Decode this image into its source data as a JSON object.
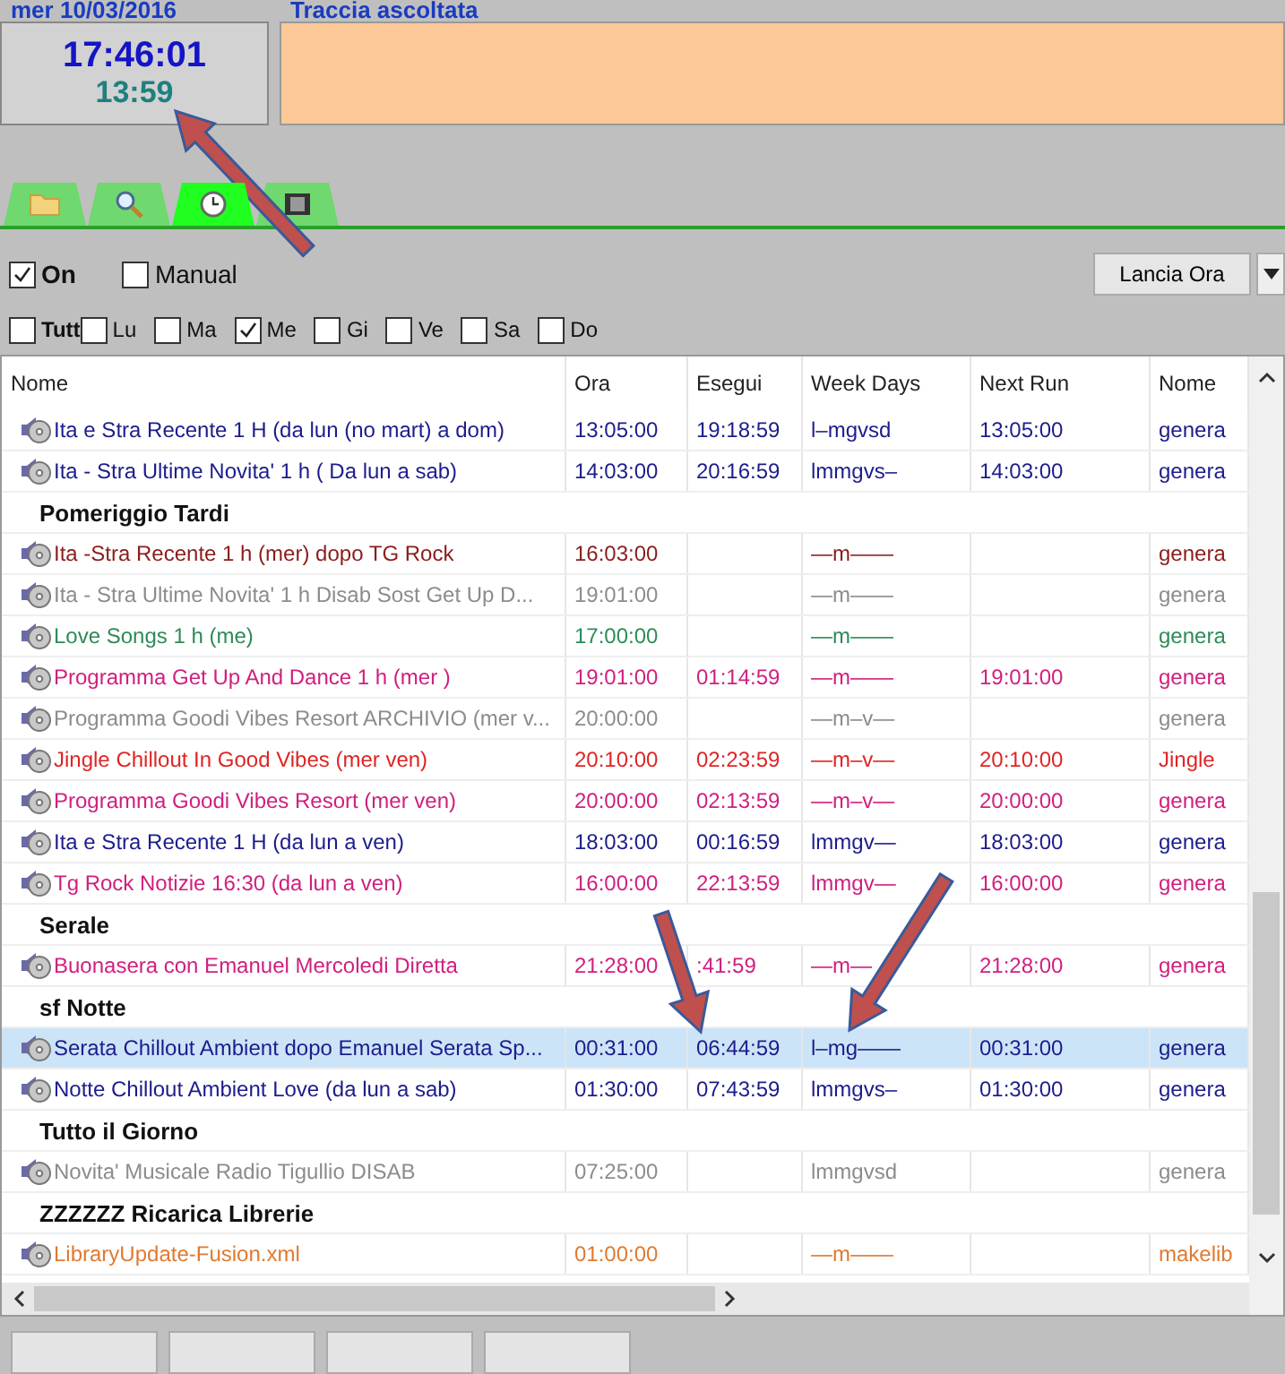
{
  "header": {
    "date": "mer 10/03/2016",
    "track_label": "Traccia ascoltata"
  },
  "clock": {
    "time": "17:46:01",
    "countdown": "13:59"
  },
  "tabs": [
    {
      "selected": false
    },
    {
      "selected": false
    },
    {
      "selected": true
    },
    {
      "selected": false
    }
  ],
  "options": [
    {
      "label": "On",
      "checked": true
    },
    {
      "label": "Manual",
      "checked": false
    }
  ],
  "run_button": "Lancia Ora",
  "days": [
    {
      "label": "Tutt",
      "checked": false
    },
    {
      "label": "Lu",
      "checked": false
    },
    {
      "label": "Ma",
      "checked": false
    },
    {
      "label": "Me",
      "checked": true
    },
    {
      "label": "Gi",
      "checked": false
    },
    {
      "label": "Ve",
      "checked": false
    },
    {
      "label": "Sa",
      "checked": false
    },
    {
      "label": "Do",
      "checked": false
    }
  ],
  "table": {
    "columns": [
      "Nome",
      "Ora",
      "Esegui",
      "Week Days",
      "Next Run",
      "Nome"
    ],
    "rows": [
      {
        "kind": "item",
        "selected": false,
        "color": "#1c1c8c",
        "cells": [
          "Ita e Stra Recente  1 H (da lun (no mart) a dom)",
          "13:05:00",
          "19:18:59",
          "l–mgvsd",
          "13:05:00",
          "genera"
        ]
      },
      {
        "kind": "item",
        "selected": false,
        "color": "#1c1c8c",
        "cells": [
          "Ita - Stra Ultime  Novita'   1 h  ( Da lun a sab)",
          "14:03:00",
          "20:16:59",
          "lmmgvs–",
          "14:03:00",
          "genera"
        ]
      },
      {
        "kind": "group",
        "label": "Pomeriggio Tardi"
      },
      {
        "kind": "item",
        "selected": false,
        "color": "#8b1c1c",
        "cells": [
          "Ita -Stra Recente 1 h (mer) dopo TG Rock",
          "16:03:00",
          "",
          "—m——",
          "",
          "genera"
        ]
      },
      {
        "kind": "item",
        "selected": false,
        "color": "#8c8c8c",
        "cells": [
          "Ita - Stra Ultime  Novita' 1 h  Disab Sost Get Up D...",
          "19:01:00",
          "",
          "—m——",
          "",
          "genera"
        ]
      },
      {
        "kind": "item",
        "selected": false,
        "color": "#2e8b57",
        "cells": [
          "Love Songs  1 h (me)",
          "17:00:00",
          "",
          "—m——",
          "",
          "genera"
        ]
      },
      {
        "kind": "item",
        "selected": false,
        "color": "#d0207f",
        "cells": [
          "Programma Get Up And Dance 1 h (mer )",
          "19:01:00",
          "01:14:59",
          "—m——",
          "19:01:00",
          "genera"
        ]
      },
      {
        "kind": "item",
        "selected": false,
        "color": "#8c8c8c",
        "cells": [
          "Programma Goodi Vibes Resort ARCHIVIO  (mer v...",
          "20:00:00",
          "",
          "—m–v—",
          "",
          "genera"
        ]
      },
      {
        "kind": "item",
        "selected": false,
        "color": "#e02424",
        "cells": [
          "Jingle Chillout In Good Vibes (mer ven)",
          "20:10:00",
          "02:23:59",
          "—m–v—",
          "20:10:00",
          "Jingle"
        ]
      },
      {
        "kind": "item",
        "selected": false,
        "color": "#d0207f",
        "cells": [
          "Programma Goodi Vibes Resort (mer ven)",
          "20:00:00",
          "02:13:59",
          "—m–v—",
          "20:00:00",
          "genera"
        ]
      },
      {
        "kind": "item",
        "selected": false,
        "color": "#1c1c8c",
        "cells": [
          "Ita e Stra Recente  1 H (da lun a ven)",
          "18:03:00",
          "00:16:59",
          "lmmgv—",
          "18:03:00",
          "genera"
        ]
      },
      {
        "kind": "item",
        "selected": false,
        "color": "#d0207f",
        "cells": [
          "Tg Rock Notizie 16:30 (da lun a ven)",
          "16:00:00",
          "22:13:59",
          "lmmgv—",
          "16:00:00",
          "genera"
        ]
      },
      {
        "kind": "group",
        "label": "Serale"
      },
      {
        "kind": "item",
        "selected": false,
        "color": "#d0207f",
        "cells": [
          "Buonasera con Emanuel Mercoledi Diretta",
          "21:28:00",
          ":41:59",
          "—m—",
          "21:28:00",
          "genera"
        ]
      },
      {
        "kind": "group",
        "label": "sf  Notte"
      },
      {
        "kind": "item",
        "selected": true,
        "color": "#1c1c8c",
        "cells": [
          "Serata Chillout Ambient dopo Emanuel Serata Sp...",
          "00:31:00",
          "06:44:59",
          "l–mg——",
          "00:31:00",
          "genera"
        ]
      },
      {
        "kind": "item",
        "selected": false,
        "color": "#1c1c8c",
        "cells": [
          "Notte Chillout Ambient Love (da lun a sab)",
          "01:30:00",
          "07:43:59",
          "lmmgvs–",
          "01:30:00",
          "genera"
        ]
      },
      {
        "kind": "group",
        "label": "Tutto il Giorno"
      },
      {
        "kind": "item",
        "selected": false,
        "color": "#8c8c8c",
        "cells": [
          "Novita' Musicale Radio Tigullio DISAB",
          "07:25:00",
          "",
          "lmmgvsd",
          "",
          "genera"
        ]
      },
      {
        "kind": "group",
        "label": "ZZZZZZ Ricarica Librerie"
      },
      {
        "kind": "item",
        "selected": false,
        "color": "#e07a30",
        "cells": [
          "LibraryUpdate-Fusion.xml",
          "01:00:00",
          "",
          "—m——",
          "",
          "makelib"
        ]
      }
    ]
  }
}
